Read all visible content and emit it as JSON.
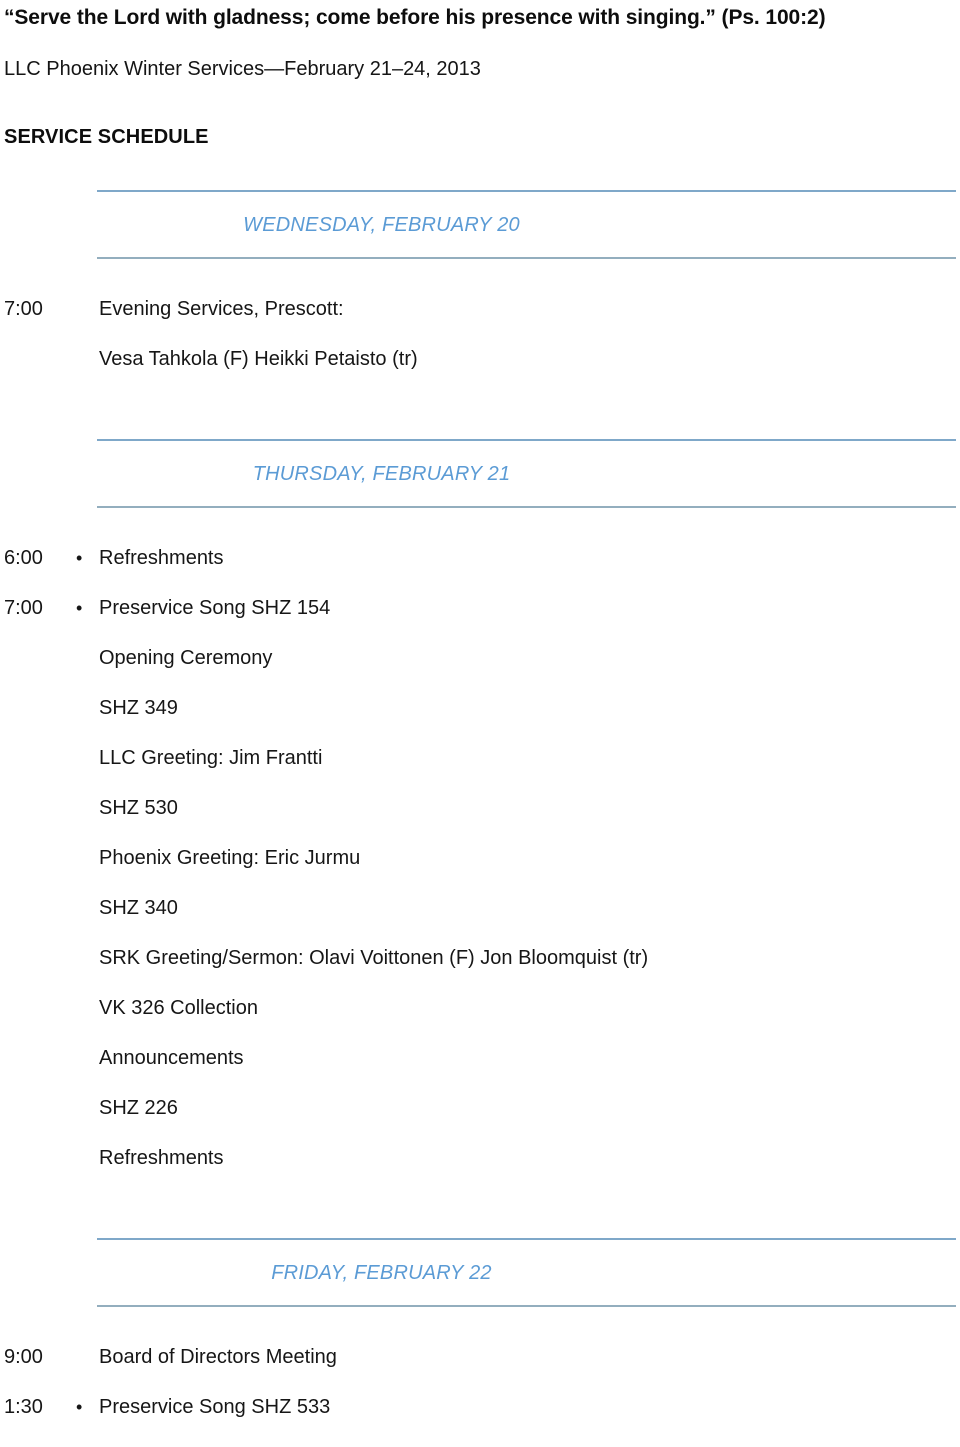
{
  "document": {
    "scripture_quote": "“Serve the Lord with gladness; come before his presence with singing.” (Ps. 100:2)",
    "event_title": "LLC Phoenix Winter Services—February 21–24, 2013",
    "section_heading": "SERVICE SCHEDULE"
  },
  "colors": {
    "day_label": "#5B9BD5",
    "rule": "#90AEC4",
    "body_text": "#161616"
  },
  "bullet_glyph": "•",
  "days": [
    {
      "label": "WEDNESDAY, FEBRUARY 20",
      "items": [
        {
          "time": "7:00",
          "bullet": false,
          "text": "Evening Services, Prescott:"
        },
        {
          "time": "",
          "bullet": false,
          "text": "Vesa Tahkola (F) Heikki Petaisto (tr)"
        }
      ]
    },
    {
      "label": "THURSDAY, FEBRUARY 21",
      "items": [
        {
          "time": "6:00",
          "bullet": true,
          "text": "Refreshments"
        },
        {
          "time": "7:00",
          "bullet": true,
          "text": "Preservice Song SHZ 154"
        },
        {
          "time": "",
          "bullet": false,
          "text": "Opening Ceremony"
        },
        {
          "time": "",
          "bullet": false,
          "text": "SHZ 349"
        },
        {
          "time": "",
          "bullet": false,
          "text": "LLC Greeting: Jim Frantti"
        },
        {
          "time": "",
          "bullet": false,
          "text": "SHZ 530"
        },
        {
          "time": "",
          "bullet": false,
          "text": "Phoenix Greeting: Eric Jurmu"
        },
        {
          "time": "",
          "bullet": false,
          "text": "SHZ 340"
        },
        {
          "time": "",
          "bullet": false,
          "text": "SRK Greeting/Sermon: Olavi Voittonen (F) Jon Bloomquist (tr)"
        },
        {
          "time": "",
          "bullet": false,
          "text": "VK 326 Collection"
        },
        {
          "time": "",
          "bullet": false,
          "text": "Announcements"
        },
        {
          "time": "",
          "bullet": false,
          "text": "SHZ 226"
        },
        {
          "time": "",
          "bullet": false,
          "text": "Refreshments"
        }
      ]
    },
    {
      "label": "FRIDAY, FEBRUARY 22",
      "items": [
        {
          "time": "9:00",
          "bullet": false,
          "text": "Board of Directors Meeting"
        },
        {
          "time": "1:30",
          "bullet": true,
          "text": "Preservice Song SHZ 533"
        }
      ]
    }
  ]
}
